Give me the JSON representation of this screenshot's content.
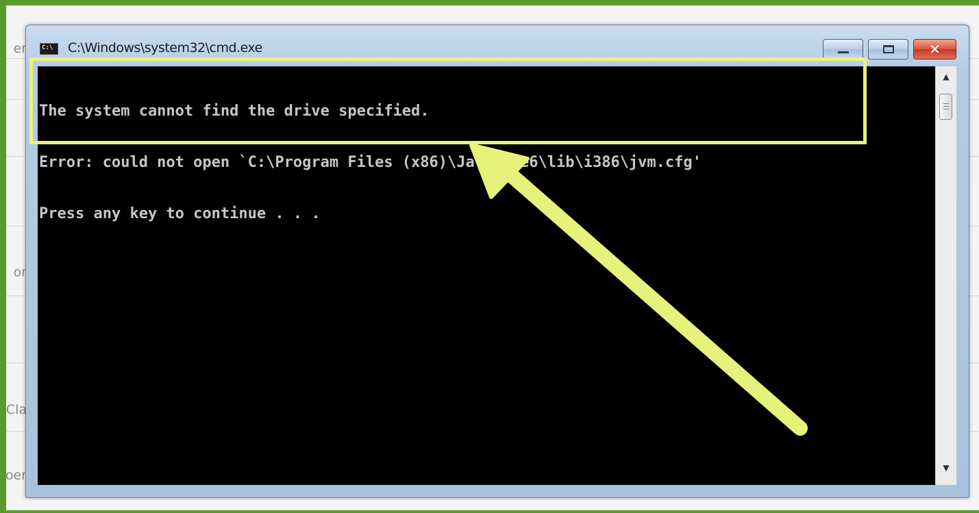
{
  "background": {
    "fragments": [
      "er",
      "or",
      "Cla",
      "oer"
    ]
  },
  "window": {
    "title": "C:\\Windows\\system32\\cmd.exe",
    "icon": "cmd-icon",
    "controls": {
      "minimize_icon": "minimize-icon",
      "maximize_icon": "maximize-icon",
      "close_symbol": "✕"
    }
  },
  "console": {
    "lines": [
      "The system cannot find the drive specified.",
      "Error: could not open `C:\\Program Files (x86)\\Java\\jre6\\lib\\i386\\jvm.cfg'",
      "Press any key to continue . . ."
    ],
    "scroll_up_symbol": "▲",
    "scroll_down_symbol": "▼"
  },
  "annotation": {
    "highlight_color": "#e8f27d",
    "arrow_icon": "arrow-icon"
  },
  "colors": {
    "frame": "#5a9b2e",
    "console_bg": "#000000",
    "console_text": "#c6c6c6",
    "close_button": "#c94a30"
  }
}
